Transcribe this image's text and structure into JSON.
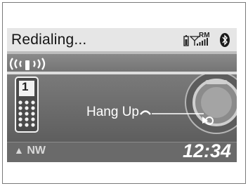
{
  "header": {
    "title": "Redialing...",
    "icons": [
      "battery-icon",
      "signal-bars-icon",
      "roaming-indicator-icon",
      "bluetooth-icon"
    ],
    "roaming_label": "RM"
  },
  "screen": {
    "incall_icon": "phone-signal-waves-icon",
    "call_status": "Hang Up",
    "hang_up_icon": "hang-up-handset-icon",
    "phone_icon_number": "1",
    "knob_icon": "interface-dial-icon"
  },
  "footer": {
    "compass": "NW",
    "compass_icon": "north-arrow-icon",
    "clock": "12:34"
  },
  "colors": {
    "header_bg": "#e6e6e6",
    "screen_bg": "#6c6c6c",
    "text_light": "#ffffff"
  }
}
